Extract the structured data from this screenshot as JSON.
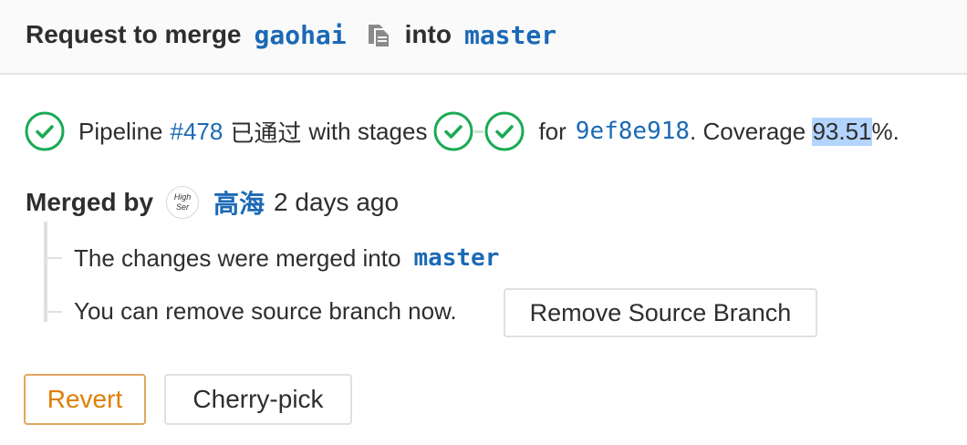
{
  "header": {
    "prefix": "Request to merge",
    "source_branch": "gaohai",
    "copy_icon": "clipboard-copy-icon",
    "into": "into",
    "target_branch": "master"
  },
  "pipeline": {
    "status_icon": "check-circle-icon",
    "label": "Pipeline",
    "id": "#478",
    "status_text": "已通过",
    "with_stages": "with stages",
    "stages": [
      {
        "status": "passed",
        "icon": "check-circle-icon"
      },
      {
        "status": "passed",
        "icon": "check-circle-icon"
      }
    ],
    "for": "for",
    "commit_sha": "9ef8e918",
    "coverage_label": ". Coverage ",
    "coverage_value": "93.51",
    "coverage_suffix": "%.",
    "color_success": "#1aaa55"
  },
  "merge_info": {
    "merged_by_label": "Merged by",
    "avatar_text_line1": "High",
    "avatar_text_line2": "Ser",
    "user": "高海",
    "time": "2 days ago"
  },
  "messages": {
    "merged_into_text": "The changes were merged into",
    "merged_into_branch": "master",
    "remove_text": "You can remove source branch now.",
    "remove_button": "Remove Source Branch"
  },
  "actions": {
    "revert": "Revert",
    "cherry_pick": "Cherry-pick",
    "revert_color": "#de7e00"
  }
}
